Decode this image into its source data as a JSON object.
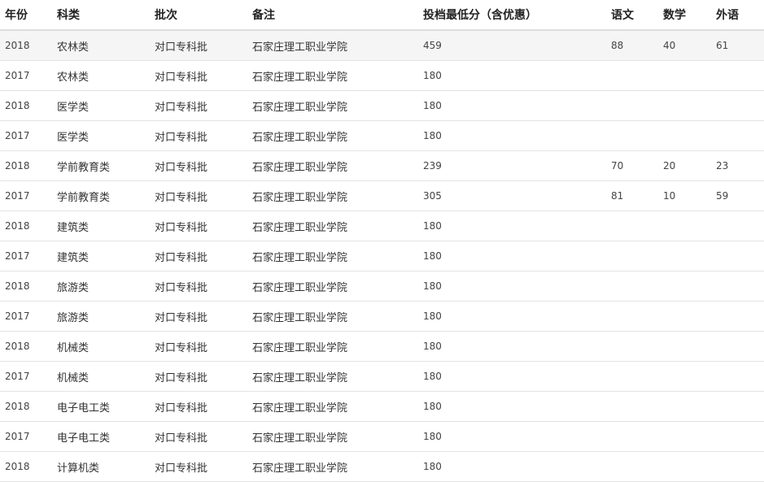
{
  "table": {
    "headers": {
      "year": "年份",
      "category": "科类",
      "batch": "批次",
      "note": "备注",
      "min_score": "投档最低分（含优惠）",
      "chinese": "语文",
      "math": "数学",
      "english": "外语"
    },
    "rows": [
      {
        "year": "2018",
        "category": "农林类",
        "batch": "对口专科批",
        "note": "石家庄理工职业学院",
        "min_score": "459",
        "chinese": "88",
        "math": "40",
        "english": "61"
      },
      {
        "year": "2017",
        "category": "农林类",
        "batch": "对口专科批",
        "note": "石家庄理工职业学院",
        "min_score": "180",
        "chinese": "",
        "math": "",
        "english": ""
      },
      {
        "year": "2018",
        "category": "医学类",
        "batch": "对口专科批",
        "note": "石家庄理工职业学院",
        "min_score": "180",
        "chinese": "",
        "math": "",
        "english": ""
      },
      {
        "year": "2017",
        "category": "医学类",
        "batch": "对口专科批",
        "note": "石家庄理工职业学院",
        "min_score": "180",
        "chinese": "",
        "math": "",
        "english": ""
      },
      {
        "year": "2018",
        "category": "学前教育类",
        "batch": "对口专科批",
        "note": "石家庄理工职业学院",
        "min_score": "239",
        "chinese": "70",
        "math": "20",
        "english": "23"
      },
      {
        "year": "2017",
        "category": "学前教育类",
        "batch": "对口专科批",
        "note": "石家庄理工职业学院",
        "min_score": "305",
        "chinese": "81",
        "math": "10",
        "english": "59"
      },
      {
        "year": "2018",
        "category": "建筑类",
        "batch": "对口专科批",
        "note": "石家庄理工职业学院",
        "min_score": "180",
        "chinese": "",
        "math": "",
        "english": ""
      },
      {
        "year": "2017",
        "category": "建筑类",
        "batch": "对口专科批",
        "note": "石家庄理工职业学院",
        "min_score": "180",
        "chinese": "",
        "math": "",
        "english": ""
      },
      {
        "year": "2018",
        "category": "旅游类",
        "batch": "对口专科批",
        "note": "石家庄理工职业学院",
        "min_score": "180",
        "chinese": "",
        "math": "",
        "english": ""
      },
      {
        "year": "2017",
        "category": "旅游类",
        "batch": "对口专科批",
        "note": "石家庄理工职业学院",
        "min_score": "180",
        "chinese": "",
        "math": "",
        "english": ""
      },
      {
        "year": "2018",
        "category": "机械类",
        "batch": "对口专科批",
        "note": "石家庄理工职业学院",
        "min_score": "180",
        "chinese": "",
        "math": "",
        "english": ""
      },
      {
        "year": "2017",
        "category": "机械类",
        "batch": "对口专科批",
        "note": "石家庄理工职业学院",
        "min_score": "180",
        "chinese": "",
        "math": "",
        "english": ""
      },
      {
        "year": "2018",
        "category": "电子电工类",
        "batch": "对口专科批",
        "note": "石家庄理工职业学院",
        "min_score": "180",
        "chinese": "",
        "math": "",
        "english": ""
      },
      {
        "year": "2017",
        "category": "电子电工类",
        "batch": "对口专科批",
        "note": "石家庄理工职业学院",
        "min_score": "180",
        "chinese": "",
        "math": "",
        "english": ""
      },
      {
        "year": "2018",
        "category": "计算机类",
        "batch": "对口专科批",
        "note": "石家庄理工职业学院",
        "min_score": "180",
        "chinese": "",
        "math": "",
        "english": ""
      }
    ]
  }
}
